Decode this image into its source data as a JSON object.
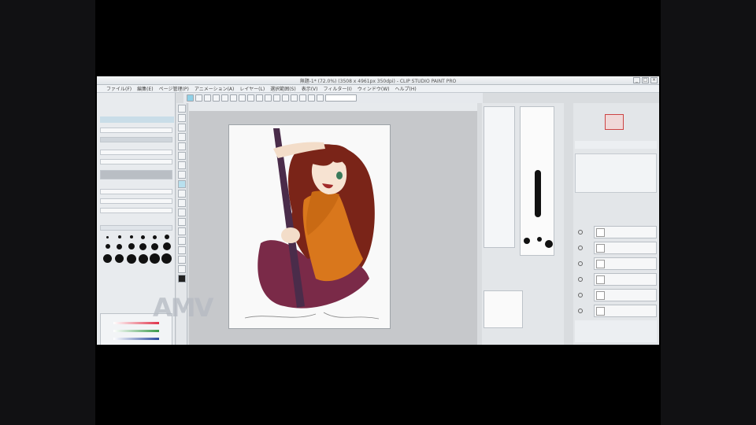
{
  "window": {
    "title": "無題-1* (72.0%) (3508 x 4961px 350dpi) - CLIP STUDIO PAINT PRO",
    "buttons": [
      "_",
      "□",
      "×"
    ]
  },
  "menu": [
    "ファイル(F)",
    "編集(E)",
    "ページ管理(P)",
    "アニメーション(A)",
    "レイヤー(L)",
    "選択範囲(S)",
    "表示(V)",
    "フィルター(I)",
    "ウィンドウ(W)",
    "ヘルプ(H)"
  ],
  "watermark": "AMV",
  "colors": {
    "accent": "#8fd0e6",
    "canvas_bg": "#c6c8cb",
    "hair": "#7a2418",
    "shirt": "#d9771c",
    "skirt": "#7a2a48",
    "staff": "#4a2c4a"
  },
  "icons": {
    "minimize": "minimize-icon",
    "maximize": "maximize-icon",
    "close": "close-icon"
  }
}
